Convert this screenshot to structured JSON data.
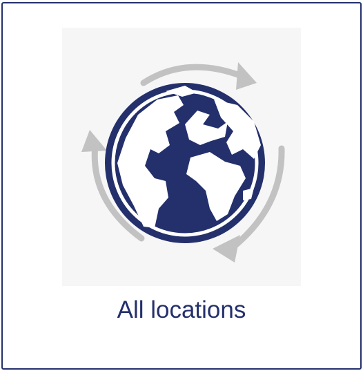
{
  "tile": {
    "label": "All locations",
    "icon": "globe-with-circular-arrows-icon"
  },
  "colors": {
    "border": "#24306c",
    "globe": "#24306c",
    "land": "#ffffff",
    "arrows": "#c2c2c2",
    "icon_background": "#f6f6f6",
    "label": "#24306c"
  }
}
